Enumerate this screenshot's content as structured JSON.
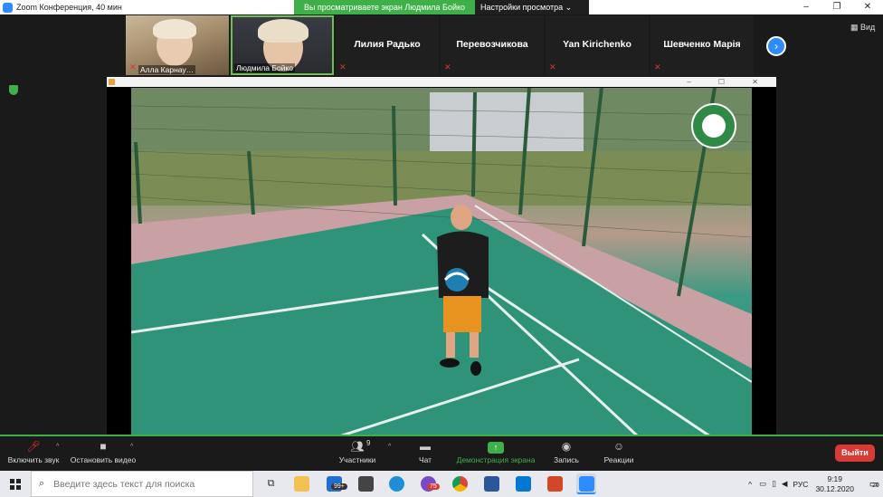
{
  "window": {
    "title": "Zoom Конференция, 40 мин",
    "controls": [
      "–",
      "❐",
      "✕"
    ]
  },
  "share_banner": {
    "message": "Вы просматриваете экран Людмила Бойко",
    "options": "Настройки просмотра ⌄"
  },
  "gallery": {
    "tiles": [
      {
        "name": "Алла Карнау…",
        "video": true,
        "muted": true
      },
      {
        "name": "Людмила Бойко",
        "video": true,
        "muted": false
      },
      {
        "name": "Лилия Радько",
        "video": false,
        "muted": true
      },
      {
        "name": "Перевозчикова",
        "video": false,
        "muted": true
      },
      {
        "name": "Yan Kirichenko",
        "video": false,
        "muted": true
      },
      {
        "name": "Шевченко Марія",
        "video": false,
        "muted": true
      }
    ],
    "next_icon": "chevron-right-icon",
    "view_label": "Вид"
  },
  "shared_window": {
    "inner_controls": "– ☐ ✕"
  },
  "controls": {
    "mute_label": "Включить звук",
    "video_label": "Остановить видео",
    "participants_label": "Участники",
    "participants_count": "9",
    "chat_label": "Чат",
    "share_label": "Демонстрация экрана",
    "record_label": "Запись",
    "reactions_label": "Реакции",
    "leave_label": "Выйти"
  },
  "taskbar": {
    "search_placeholder": "Введите здесь текст для поиска",
    "mail_badge": "99+",
    "viber_badge": "75",
    "language": "РУС",
    "time": "9:19",
    "date": "30.12.2020",
    "notifications": "20"
  },
  "colors": {
    "zoom_blue": "#2d8cff",
    "share_green": "#3fb049",
    "leave_red": "#d83b36",
    "muted_red": "#e0332e"
  }
}
